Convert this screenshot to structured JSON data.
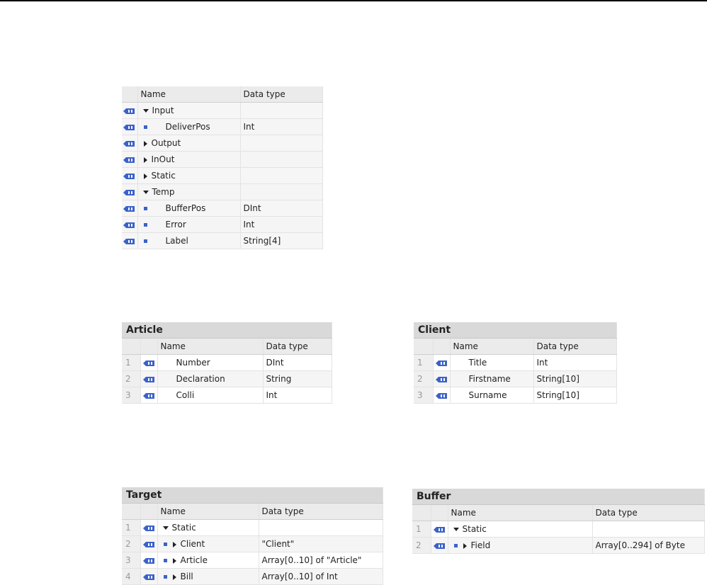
{
  "colors": {
    "icon_blue": "#3c62c8",
    "header_grey": "#ebebeb",
    "title_grey": "#d9d9d9"
  },
  "interface_table": {
    "columns": {
      "name": "Name",
      "data_type": "Data type"
    },
    "rows": [
      {
        "name": "Input",
        "type": "",
        "expander": "expanded"
      },
      {
        "name": "DeliverPos",
        "type": "Int",
        "expander": "none"
      },
      {
        "name": "Output",
        "type": "",
        "expander": "collapsed"
      },
      {
        "name": "InOut",
        "type": "",
        "expander": "collapsed"
      },
      {
        "name": "Static",
        "type": "",
        "expander": "collapsed"
      },
      {
        "name": "Temp",
        "type": "",
        "expander": "expanded"
      },
      {
        "name": "BufferPos",
        "type": "DInt",
        "expander": "none"
      },
      {
        "name": "Error",
        "type": "Int",
        "expander": "none"
      },
      {
        "name": "Label",
        "type": "String[4]",
        "expander": "none"
      }
    ]
  },
  "article_table": {
    "title": "Article",
    "columns": {
      "name": "Name",
      "data_type": "Data type"
    },
    "rows": [
      {
        "num": "1",
        "name": "Number",
        "type": "DInt"
      },
      {
        "num": "2",
        "name": "Declaration",
        "type": "String"
      },
      {
        "num": "3",
        "name": "Colli",
        "type": "Int"
      }
    ]
  },
  "client_table": {
    "title": "Client",
    "columns": {
      "name": "Name",
      "data_type": "Data type"
    },
    "rows": [
      {
        "num": "1",
        "name": "Title",
        "type": "Int"
      },
      {
        "num": "2",
        "name": "Firstname",
        "type": "String[10]"
      },
      {
        "num": "3",
        "name": "Surname",
        "type": "String[10]"
      }
    ]
  },
  "target_table": {
    "title": "Target",
    "columns": {
      "name": "Name",
      "data_type": "Data type"
    },
    "rows": [
      {
        "num": "1",
        "name": "Static",
        "type": ""
      },
      {
        "num": "2",
        "name": "Client",
        "type": "\"Client\""
      },
      {
        "num": "3",
        "name": "Article",
        "type": "Array[0..10] of \"Article\""
      },
      {
        "num": "4",
        "name": "Bill",
        "type": "Array[0..10] of Int"
      }
    ]
  },
  "buffer_table": {
    "title": "Buffer",
    "columns": {
      "name": "Name",
      "data_type": "Data type"
    },
    "rows": [
      {
        "num": "1",
        "name": "Static",
        "type": ""
      },
      {
        "num": "2",
        "name": "Field",
        "type": "Array[0..294] of Byte"
      }
    ]
  }
}
